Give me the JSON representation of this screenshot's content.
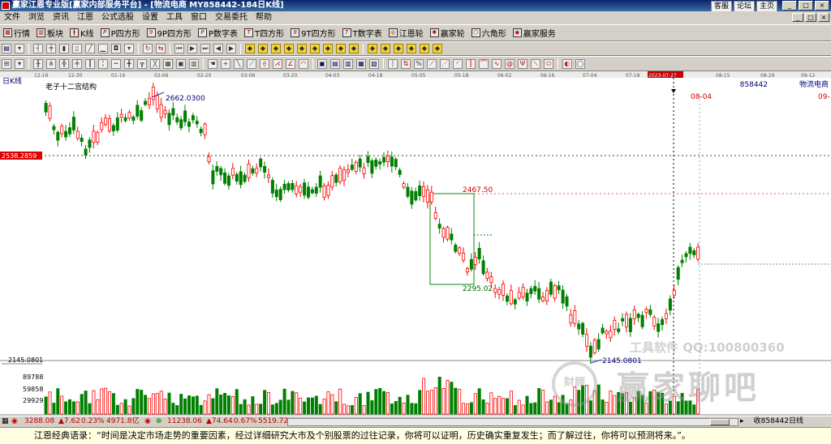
{
  "titlebar": {
    "title": "赢家江恩专业版[赢家内部服务平台] - [物流电商  MY858442-184日K线]",
    "links": [
      "客服",
      "论坛",
      "主页"
    ],
    "window_buttons": [
      "_",
      "□",
      "×"
    ]
  },
  "menu": {
    "items": [
      "文件",
      "浏览",
      "资讯",
      "江恩",
      "公式选股",
      "设置",
      "工具",
      "窗口",
      "交易委托",
      "帮助"
    ],
    "mdi_buttons": [
      "_",
      "□",
      "×"
    ]
  },
  "toolbar1": {
    "buttons": [
      {
        "label": "行情",
        "icon": "grid-icon"
      },
      {
        "label": "板块",
        "icon": "blocks-icon"
      },
      {
        "label": "K线",
        "icon": "candle-icon"
      },
      {
        "label": "P四方形",
        "icon": "p-square-icon"
      },
      {
        "label": "9P四方形",
        "icon": "9p-square-icon"
      },
      {
        "label": "P数字表",
        "icon": "p-table-icon"
      },
      {
        "label": "T四方形",
        "icon": "t-square-icon"
      },
      {
        "label": "9T四方形",
        "icon": "9t-square-icon"
      },
      {
        "label": "T数字表",
        "icon": "t-table-icon"
      },
      {
        "label": "江恩轮",
        "icon": "gann-wheel-icon"
      },
      {
        "label": "赢家轮",
        "icon": "winner-wheel-icon"
      },
      {
        "label": "六角形",
        "icon": "hexagon-icon"
      },
      {
        "label": "赢家服务",
        "icon": "service-icon"
      }
    ]
  },
  "chart": {
    "period_label": "日K线",
    "structure_label": "老子十二宫结构",
    "stock_code": "858442",
    "stock_name": "物流电商",
    "cursor_date": "2023-07-27",
    "marker_date": "08-04",
    "right_edge_label": "09-",
    "left_price_tag": "2538.2859",
    "volume_ticks": [
      "89788",
      "59858",
      "29929"
    ],
    "axis_dates": [
      "12-16",
      "12-30",
      "01-16",
      "02-06",
      "02-20",
      "03-06",
      "03-20",
      "04-03",
      "04-18",
      "05-05",
      "05-18",
      "06-02",
      "06-16",
      "07-04",
      "07-18",
      "2023-07-27",
      "08-15",
      "08-29",
      "09-12"
    ],
    "annotations": {
      "high": "2662.0300",
      "box_top": "2467.50",
      "box_bottom": "2295.02",
      "low": "2145.0801",
      "low_left": "2145.0801"
    },
    "colors": {
      "up": "#ff0000",
      "down": "#008000",
      "cursor": "#000000"
    }
  },
  "watermark": {
    "line1": "工具软件  QQ:100800360",
    "line2": "赢家聊吧",
    "logo": "财顾"
  },
  "status": {
    "sh_index": "3288.08",
    "sh_change": "▲7.62",
    "sh_pct": "0.23%",
    "sh_amount": "4971.8亿",
    "sz_index": "11238.06",
    "sz_change": "▲74.64",
    "sz_pct": "0.67%",
    "sz_amount": "5519.72",
    "right_info": "收858442日线"
  },
  "quote": {
    "text": "江恩经典语录：“时间是决定市场走势的重要因素，经过详细研究大市及个别股票的过往记录，你将可以证明，历史确实重复发生；而了解过往，你将可以预测将来。”。"
  }
}
